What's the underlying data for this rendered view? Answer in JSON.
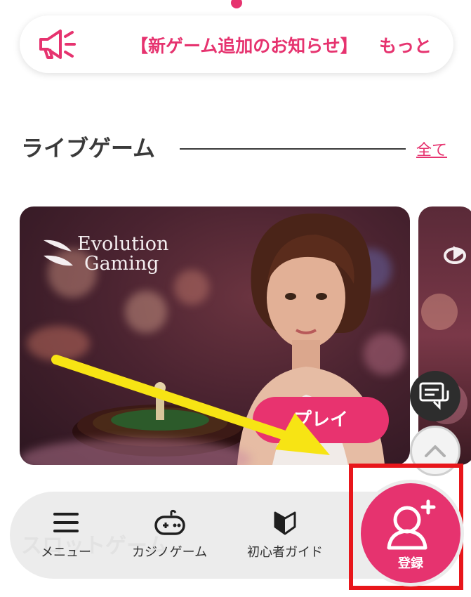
{
  "notice": {
    "text": "【新ゲーム追加のお知らせ】",
    "more": "もっと",
    "icon": "megaphone-icon"
  },
  "live_section": {
    "title": "ライブゲーム",
    "all_link": "全て"
  },
  "game_card": {
    "provider": "Evolution\nGaming",
    "play_label": "プレイ"
  },
  "floating": {
    "chat_icon": "chat-icon",
    "scroll_top_icon": "chevron-up-icon"
  },
  "bottom_nav": {
    "ghost_text": "スロットゲーム",
    "items": [
      {
        "label": "メニュー",
        "icon": "menu-icon"
      },
      {
        "label": "カジノゲーム",
        "icon": "gamepad-icon"
      },
      {
        "label": "初心者ガイド",
        "icon": "beginner-mark-icon"
      }
    ],
    "register_label": "登録",
    "register_icon": "add-user-icon"
  },
  "colors": {
    "accent": "#e6336f",
    "highlight_box": "#e8161b",
    "arrow": "#f7e414"
  }
}
